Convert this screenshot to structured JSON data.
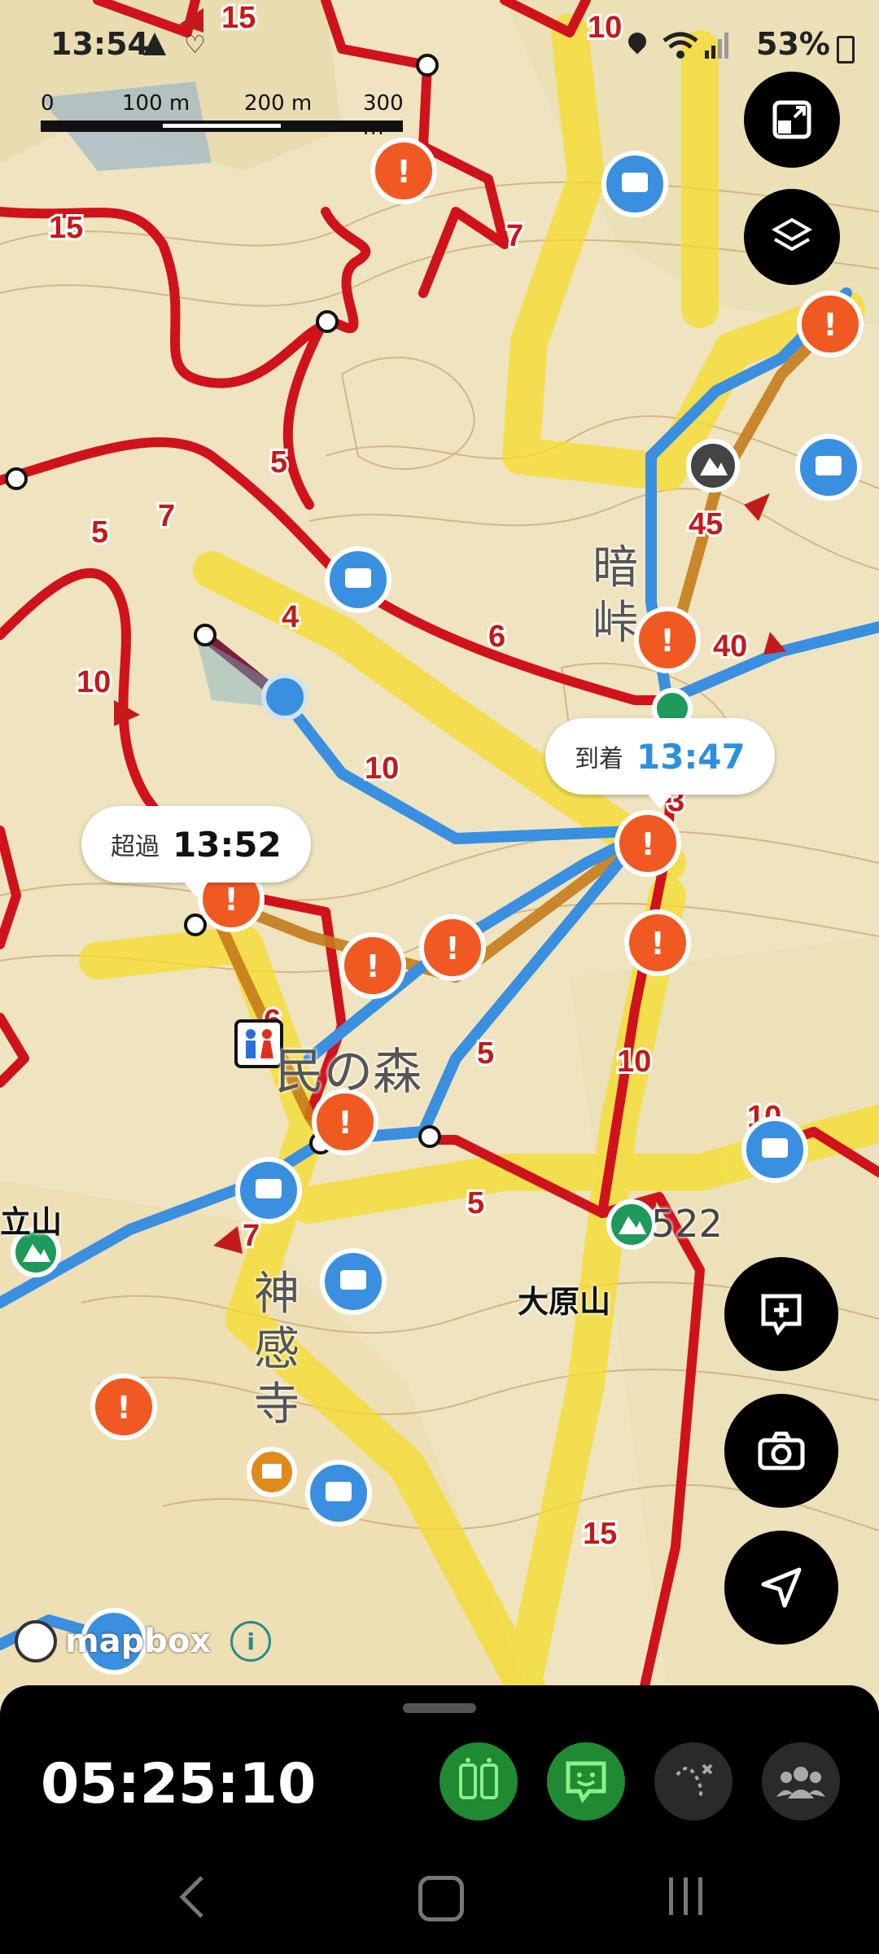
{
  "status_bar": {
    "time": "13:54",
    "battery": "53%"
  },
  "scale": {
    "labels": [
      "0",
      "100 m",
      "200 m",
      "300 m"
    ]
  },
  "route_labels": [
    "15",
    "10",
    "7",
    "15",
    "5",
    "7",
    "5",
    "4",
    "6",
    "10",
    "10",
    "45",
    "40",
    "3",
    "6",
    "5",
    "10",
    "10",
    "5",
    "7",
    "15",
    "45"
  ],
  "place_labels": {
    "mountain_left": "立山",
    "mountain_right": "大原山",
    "temple": "神感寺",
    "forest": "民の森",
    "pass": "暗峠",
    "elev_522": "522"
  },
  "callouts": {
    "arrival": {
      "key": "到着",
      "time": "13:47",
      "color": "#2d8fe0"
    },
    "overdue": {
      "key": "超過",
      "time": "13:52",
      "color": "#111111"
    }
  },
  "attribution": {
    "logo": "mapbox"
  },
  "fabs": {
    "top": [
      "fit-screen-icon",
      "layers-icon"
    ],
    "bottom": [
      "add-post-icon",
      "camera-icon",
      "navigate-icon"
    ]
  },
  "bottom_sheet": {
    "elapsed": "05:25:10",
    "buttons": [
      "hiking-pace-icon",
      "post-icon",
      "route-icon",
      "group-icon"
    ],
    "accent": "#1f8a32"
  },
  "colors": {
    "route_red": "#d0121b",
    "track_blue": "#3a8fe0",
    "warn_orange": "#f05a22",
    "highlight_yellow": "#f5dc2a"
  }
}
